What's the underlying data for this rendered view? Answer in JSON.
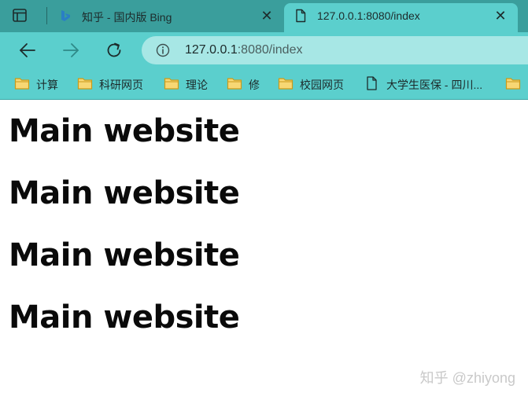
{
  "tabs": [
    {
      "title": "知乎 - 国内版 Bing",
      "icon": "bing-icon",
      "active": false,
      "close_label": "✕"
    },
    {
      "title": "127.0.0.1:8080/index",
      "icon": "page-icon",
      "active": true,
      "close_label": "✕"
    }
  ],
  "toolbar": {
    "url_host": "127.0.0.1",
    "url_rest": ":8080/index"
  },
  "bookmarks": [
    {
      "label": "计算",
      "icon": "folder-icon"
    },
    {
      "label": "科研网页",
      "icon": "folder-icon"
    },
    {
      "label": "理论",
      "icon": "folder-icon"
    },
    {
      "label": "修",
      "icon": "folder-icon"
    },
    {
      "label": "校园网页",
      "icon": "folder-icon"
    },
    {
      "label": "大学生医保 - 四川...",
      "icon": "page-icon"
    },
    {
      "label": "",
      "icon": "folder-icon"
    }
  ],
  "page": {
    "headings": [
      "Main website",
      "Main website",
      "Main website",
      "Main website"
    ],
    "watermark": "知乎 @zhiyong"
  },
  "colors": {
    "tabstrip": "#3a9e9c",
    "toolbar": "#5bcfcd",
    "omnibox": "#a7e7e5",
    "folder_fill": "#f7d774",
    "folder_stroke": "#c99a1a"
  }
}
